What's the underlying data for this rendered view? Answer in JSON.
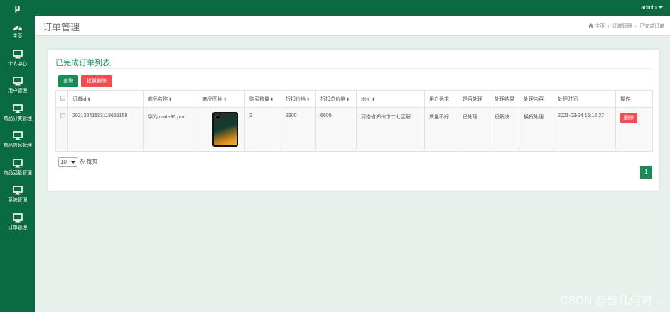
{
  "topbar": {
    "logo": "μ",
    "user": "admin"
  },
  "sidebar": {
    "items": [
      {
        "label": "主页",
        "icon": "dashboard-icon"
      },
      {
        "label": "个人中心",
        "icon": "monitor-icon"
      },
      {
        "label": "用户管理",
        "icon": "monitor-icon"
      },
      {
        "label": "商品分类管理",
        "icon": "monitor-icon"
      },
      {
        "label": "商品信息管理",
        "icon": "monitor-icon"
      },
      {
        "label": "商品回复管理",
        "icon": "monitor-icon"
      },
      {
        "label": "系统管理",
        "icon": "monitor-icon"
      },
      {
        "label": "订单管理",
        "icon": "monitor-icon"
      }
    ]
  },
  "header": {
    "title": "订单管理",
    "breadcrumb": [
      "主页",
      "订单管理",
      "已完成订单"
    ]
  },
  "panel": {
    "title": "已完成订单列表",
    "query_button": "查询",
    "batch_delete_button": "批量删除"
  },
  "table": {
    "columns": [
      "订单id",
      "商品名称",
      "商品图片",
      "购买数量",
      "折扣价格",
      "折扣总价格",
      "地址",
      "用户诉求",
      "是否处理",
      "处理结果",
      "处理内容",
      "处理时间",
      "操作"
    ],
    "rows": [
      {
        "order_id": "20213241583118655159",
        "product_name": "华为 mate30 pro",
        "quantity": "2",
        "discount_price": "3300",
        "discount_total": "6600",
        "address": "河南省郑州市二七区解...",
        "user_request": "质量不好",
        "processed": "已处理",
        "result": "已解决",
        "content": "换货处理",
        "time": "2021-03-24 15:12:27",
        "delete_label": "删除"
      }
    ]
  },
  "pagination": {
    "page_size": "10",
    "per_page_label": "条 每页",
    "current_page": "1"
  },
  "colors": {
    "brand_green": "#0a6b43",
    "accent_green": "#1a8a56",
    "danger_red": "#f24e52"
  },
  "watermark": "CSDN @曾几何时…"
}
